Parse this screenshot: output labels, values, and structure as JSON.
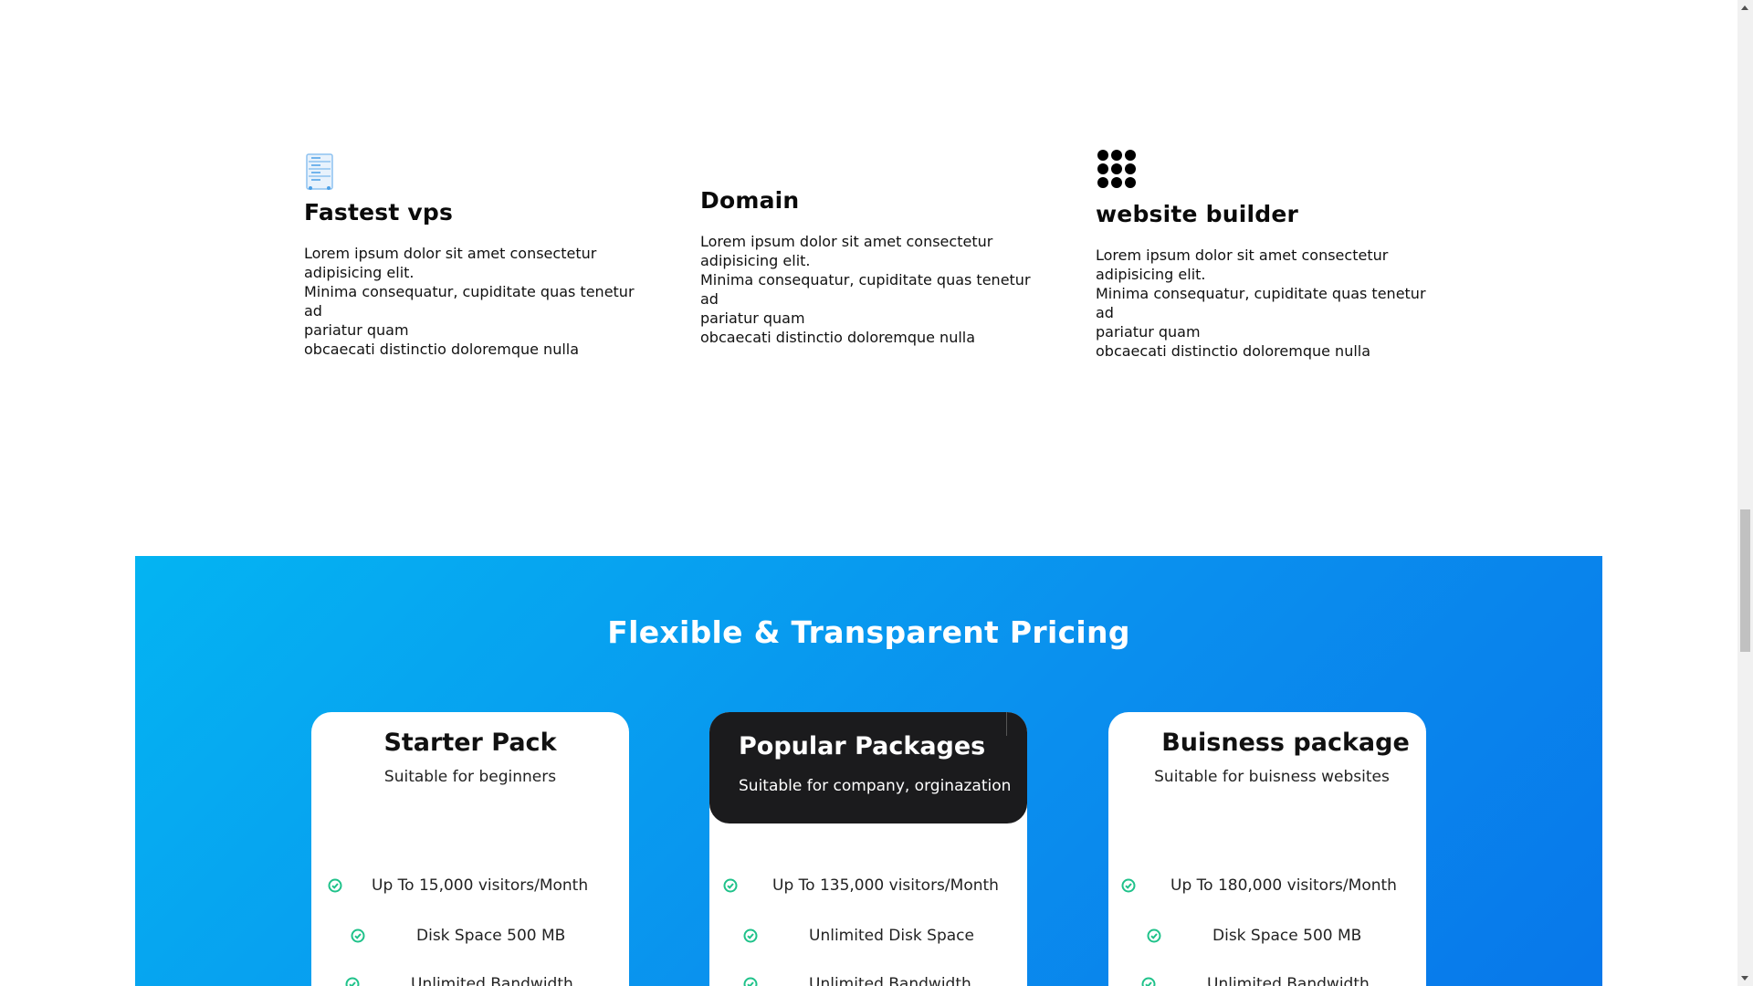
{
  "features": [
    {
      "icon": "server-icon",
      "title": "Fastest vps",
      "lines": [
        "Lorem ipsum dolor sit amet consectetur",
        "adipisicing elit.",
        "Minima consequatur, cupiditate quas tenetur ad",
        "pariatur quam",
        "obcaecati distinctio doloremque nulla"
      ]
    },
    {
      "icon": "",
      "title": "Domain",
      "lines": [
        "Lorem ipsum dolor sit amet consectetur",
        "adipisicing elit.",
        "Minima consequatur, cupiditate quas tenetur ad",
        "pariatur quam",
        "obcaecati distinctio doloremque nulla"
      ]
    },
    {
      "icon": "grid-dots-icon",
      "title": "website builder",
      "lines": [
        "Lorem ipsum dolor sit amet consectetur",
        "adipisicing elit.",
        "Minima consequatur, cupiditate quas tenetur ad",
        "pariatur quam",
        "obcaecati distinctio doloremque nulla"
      ]
    }
  ],
  "pricing": {
    "title": "Flexible & Transparent Pricing",
    "background_colors": [
      "#04b4f2",
      "#0877ea"
    ],
    "check_color": "#1fc28a",
    "cards": [
      {
        "name": "Starter Pack",
        "description": "Suitable for beginners",
        "features": [
          "Up To 15,000 visitors/Month",
          "Disk Space 500 MB",
          "Unlimited Bandwidth"
        ]
      },
      {
        "name": "Popular Packages",
        "description": "Suitable for company, orginazation",
        "highlighted": true,
        "features": [
          "Up To 135,000 visitors/Month",
          "Unlimited Disk Space",
          "Unlimited Bandwidth"
        ]
      },
      {
        "name": "Buisness package",
        "description": "Suitable for buisness websites",
        "features": [
          "Up To 180,000 visitors/Month",
          "Disk Space 500 MB",
          "Unlimited Bandwidth"
        ]
      }
    ]
  }
}
